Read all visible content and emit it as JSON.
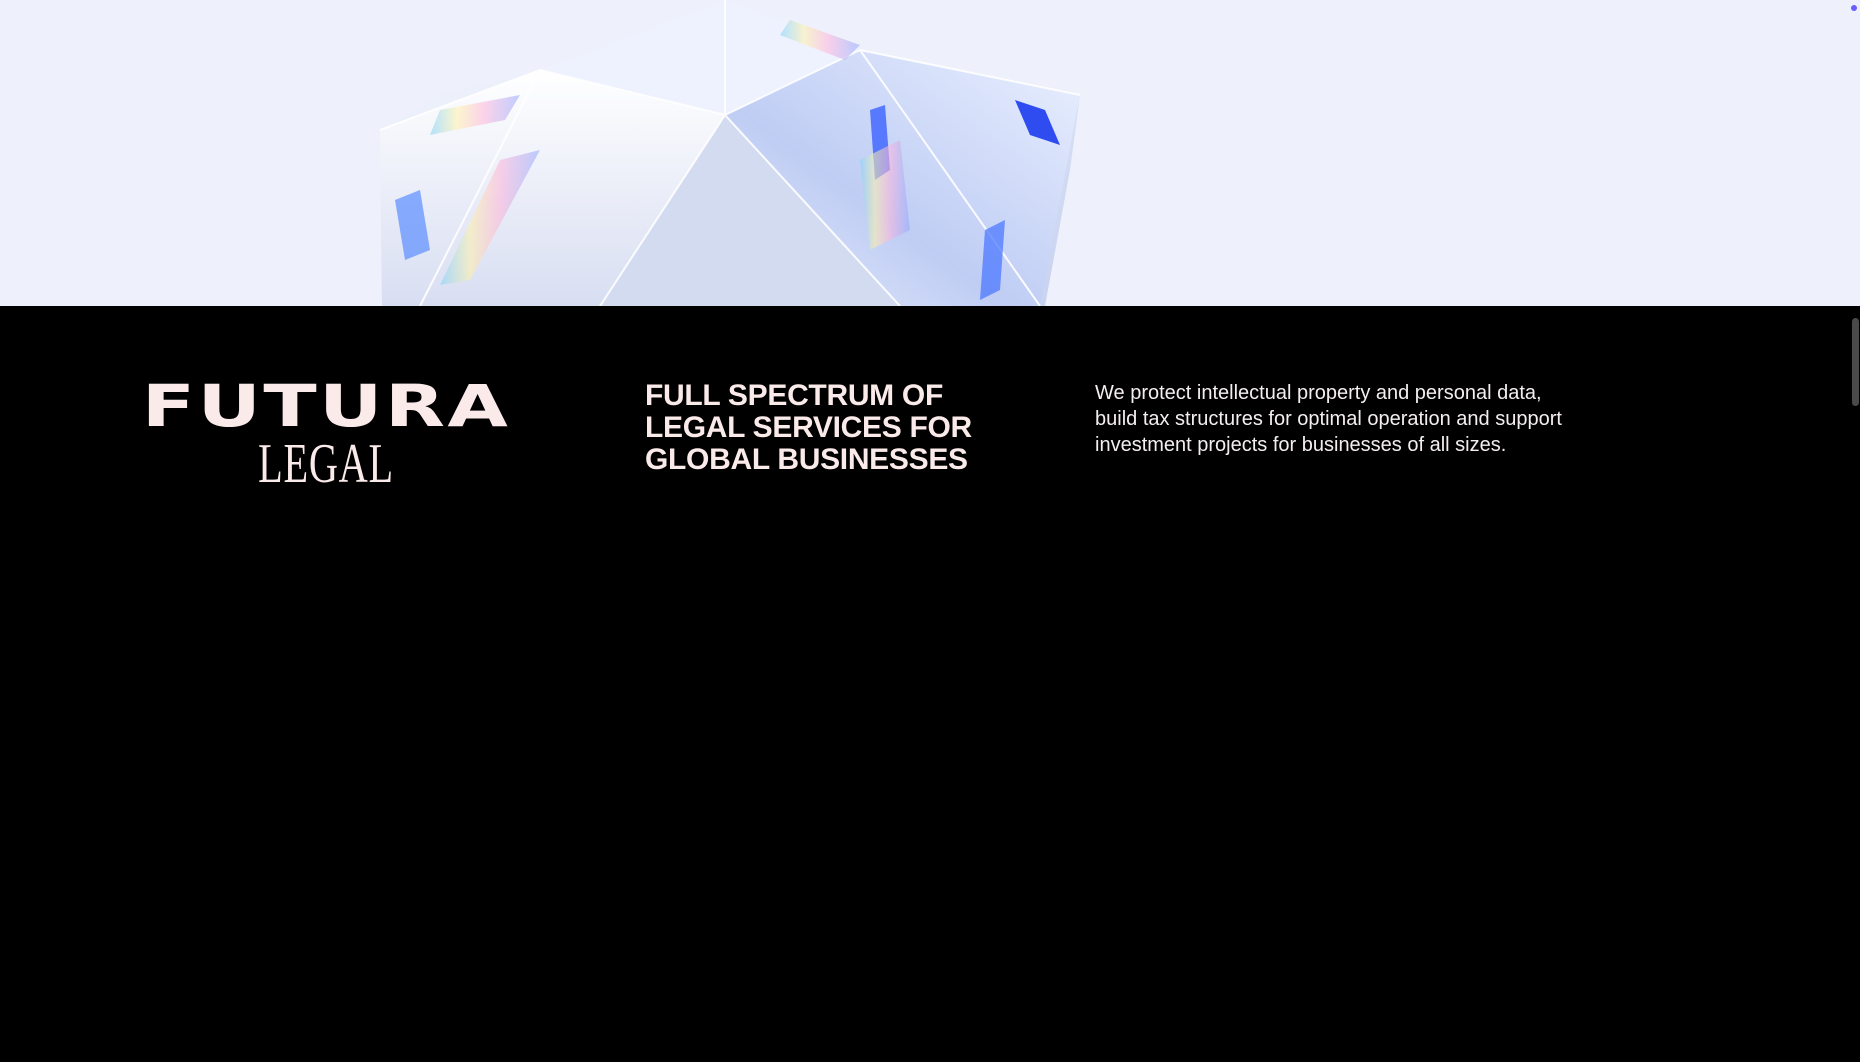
{
  "hero": {
    "background": "#eef1fb",
    "image": "crystal-prism"
  },
  "brand": {
    "logo_top": "FUTURA",
    "logo_bottom": "LEGAL",
    "color": "#fbeaea"
  },
  "tagline": "FULL SPECTRUM OF LEGAL SERVICES FOR GLOBAL BUSINESSES",
  "description": "We protect intellectual property and personal data, build tax structures for optimal operation and support investment projects for businesses of all sizes.",
  "colors": {
    "footer_background": "#000000",
    "accent_dot": "#6a5cff"
  }
}
